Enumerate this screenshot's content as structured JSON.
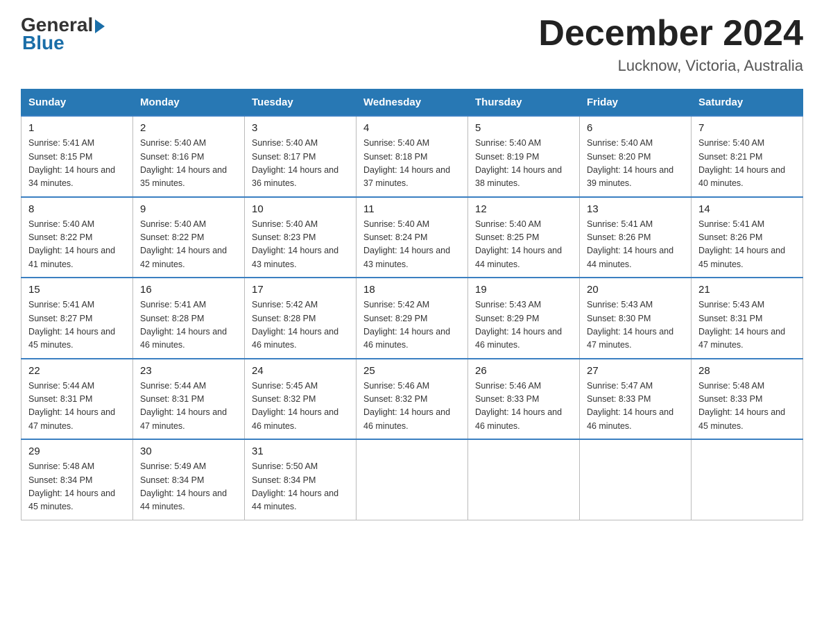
{
  "logo": {
    "general": "General",
    "blue": "Blue"
  },
  "title": "December 2024",
  "location": "Lucknow, Victoria, Australia",
  "weekdays": [
    "Sunday",
    "Monday",
    "Tuesday",
    "Wednesday",
    "Thursday",
    "Friday",
    "Saturday"
  ],
  "weeks": [
    [
      {
        "day": "1",
        "sunrise": "5:41 AM",
        "sunset": "8:15 PM",
        "daylight": "14 hours and 34 minutes."
      },
      {
        "day": "2",
        "sunrise": "5:40 AM",
        "sunset": "8:16 PM",
        "daylight": "14 hours and 35 minutes."
      },
      {
        "day": "3",
        "sunrise": "5:40 AM",
        "sunset": "8:17 PM",
        "daylight": "14 hours and 36 minutes."
      },
      {
        "day": "4",
        "sunrise": "5:40 AM",
        "sunset": "8:18 PM",
        "daylight": "14 hours and 37 minutes."
      },
      {
        "day": "5",
        "sunrise": "5:40 AM",
        "sunset": "8:19 PM",
        "daylight": "14 hours and 38 minutes."
      },
      {
        "day": "6",
        "sunrise": "5:40 AM",
        "sunset": "8:20 PM",
        "daylight": "14 hours and 39 minutes."
      },
      {
        "day": "7",
        "sunrise": "5:40 AM",
        "sunset": "8:21 PM",
        "daylight": "14 hours and 40 minutes."
      }
    ],
    [
      {
        "day": "8",
        "sunrise": "5:40 AM",
        "sunset": "8:22 PM",
        "daylight": "14 hours and 41 minutes."
      },
      {
        "day": "9",
        "sunrise": "5:40 AM",
        "sunset": "8:22 PM",
        "daylight": "14 hours and 42 minutes."
      },
      {
        "day": "10",
        "sunrise": "5:40 AM",
        "sunset": "8:23 PM",
        "daylight": "14 hours and 43 minutes."
      },
      {
        "day": "11",
        "sunrise": "5:40 AM",
        "sunset": "8:24 PM",
        "daylight": "14 hours and 43 minutes."
      },
      {
        "day": "12",
        "sunrise": "5:40 AM",
        "sunset": "8:25 PM",
        "daylight": "14 hours and 44 minutes."
      },
      {
        "day": "13",
        "sunrise": "5:41 AM",
        "sunset": "8:26 PM",
        "daylight": "14 hours and 44 minutes."
      },
      {
        "day": "14",
        "sunrise": "5:41 AM",
        "sunset": "8:26 PM",
        "daylight": "14 hours and 45 minutes."
      }
    ],
    [
      {
        "day": "15",
        "sunrise": "5:41 AM",
        "sunset": "8:27 PM",
        "daylight": "14 hours and 45 minutes."
      },
      {
        "day": "16",
        "sunrise": "5:41 AM",
        "sunset": "8:28 PM",
        "daylight": "14 hours and 46 minutes."
      },
      {
        "day": "17",
        "sunrise": "5:42 AM",
        "sunset": "8:28 PM",
        "daylight": "14 hours and 46 minutes."
      },
      {
        "day": "18",
        "sunrise": "5:42 AM",
        "sunset": "8:29 PM",
        "daylight": "14 hours and 46 minutes."
      },
      {
        "day": "19",
        "sunrise": "5:43 AM",
        "sunset": "8:29 PM",
        "daylight": "14 hours and 46 minutes."
      },
      {
        "day": "20",
        "sunrise": "5:43 AM",
        "sunset": "8:30 PM",
        "daylight": "14 hours and 47 minutes."
      },
      {
        "day": "21",
        "sunrise": "5:43 AM",
        "sunset": "8:31 PM",
        "daylight": "14 hours and 47 minutes."
      }
    ],
    [
      {
        "day": "22",
        "sunrise": "5:44 AM",
        "sunset": "8:31 PM",
        "daylight": "14 hours and 47 minutes."
      },
      {
        "day": "23",
        "sunrise": "5:44 AM",
        "sunset": "8:31 PM",
        "daylight": "14 hours and 47 minutes."
      },
      {
        "day": "24",
        "sunrise": "5:45 AM",
        "sunset": "8:32 PM",
        "daylight": "14 hours and 46 minutes."
      },
      {
        "day": "25",
        "sunrise": "5:46 AM",
        "sunset": "8:32 PM",
        "daylight": "14 hours and 46 minutes."
      },
      {
        "day": "26",
        "sunrise": "5:46 AM",
        "sunset": "8:33 PM",
        "daylight": "14 hours and 46 minutes."
      },
      {
        "day": "27",
        "sunrise": "5:47 AM",
        "sunset": "8:33 PM",
        "daylight": "14 hours and 46 minutes."
      },
      {
        "day": "28",
        "sunrise": "5:48 AM",
        "sunset": "8:33 PM",
        "daylight": "14 hours and 45 minutes."
      }
    ],
    [
      {
        "day": "29",
        "sunrise": "5:48 AM",
        "sunset": "8:34 PM",
        "daylight": "14 hours and 45 minutes."
      },
      {
        "day": "30",
        "sunrise": "5:49 AM",
        "sunset": "8:34 PM",
        "daylight": "14 hours and 44 minutes."
      },
      {
        "day": "31",
        "sunrise": "5:50 AM",
        "sunset": "8:34 PM",
        "daylight": "14 hours and 44 minutes."
      },
      null,
      null,
      null,
      null
    ]
  ]
}
